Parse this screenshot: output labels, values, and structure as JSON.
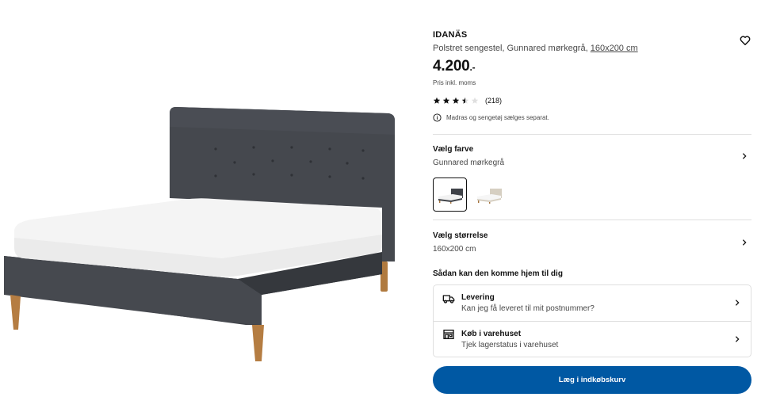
{
  "product": {
    "name": "IDANÄS",
    "description_prefix": "Polstret sengestel, Gunnared mørkegrå, ",
    "size_link": "160x200 cm",
    "price": "4.200",
    "price_suffix": ".-",
    "vat_note": "Pris inkl. moms",
    "rating_value": 3.5,
    "rating_max": 5,
    "review_count": "(218)",
    "notice": "Madras og sengetøj sælges separat."
  },
  "color_option": {
    "label": "Vælg farve",
    "value": "Gunnared mørkegrå",
    "swatches": [
      {
        "selected": true,
        "color": "#3f4248"
      },
      {
        "selected": false,
        "color": "#d6cfc2"
      }
    ]
  },
  "size_option": {
    "label": "Vælg størrelse",
    "value": "160x200 cm"
  },
  "delivery": {
    "title": "Sådan kan den komme hjem til dig",
    "rows": [
      {
        "icon": "truck-icon",
        "head": "Levering",
        "sub": "Kan jeg få leveret til mit postnummer?"
      },
      {
        "icon": "store-icon",
        "head": "Køb i varehuset",
        "sub": "Tjek lagerstatus i varehuset"
      }
    ]
  },
  "cta": {
    "label": "Læg i indkøbskurv",
    "color": "#0058a3"
  },
  "icons": {
    "favorite": "heart-icon",
    "info": "info-icon",
    "chevron": "chevron-right-icon"
  }
}
